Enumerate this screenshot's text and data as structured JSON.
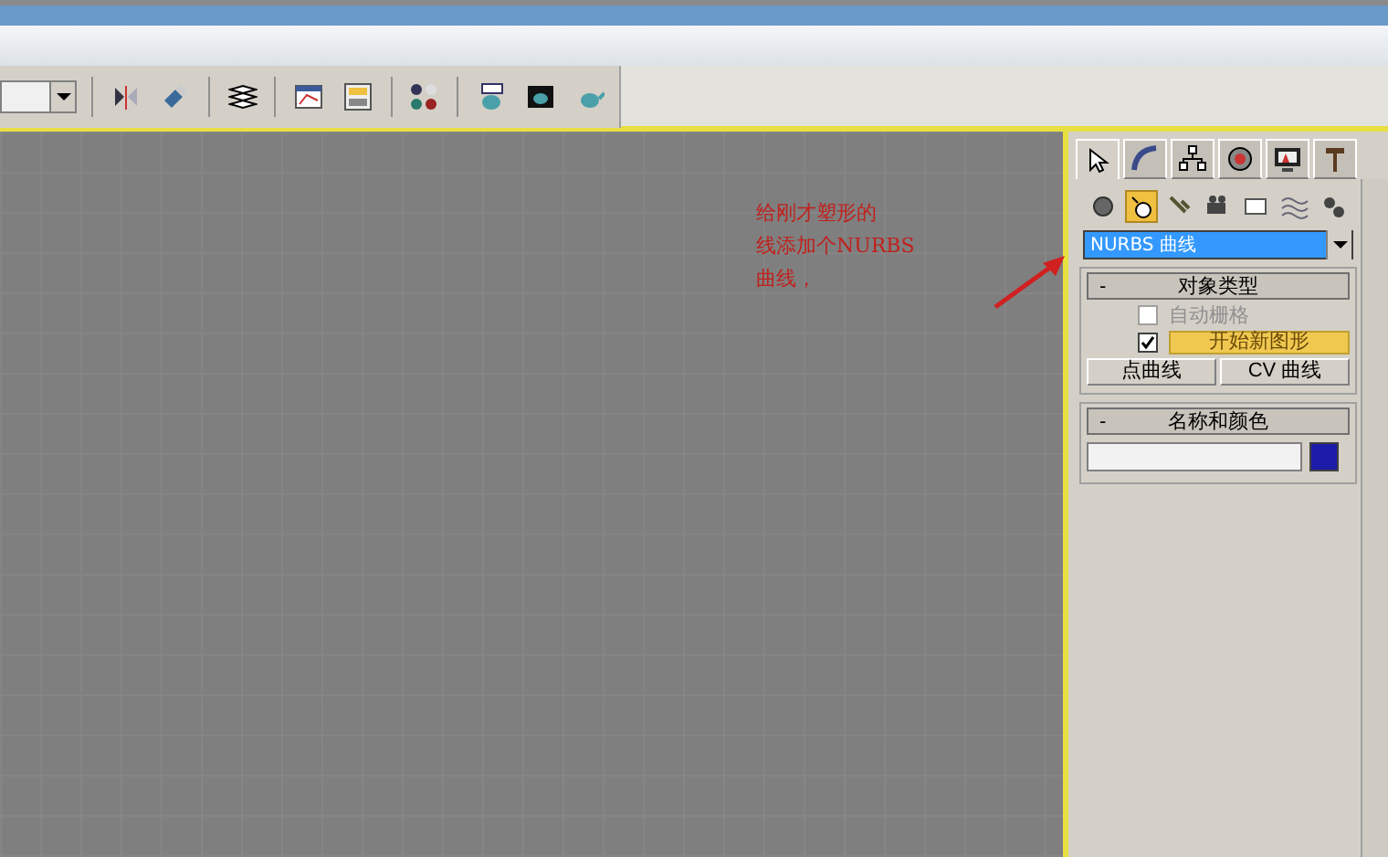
{
  "viewport": {
    "annotation": [
      "给刚才塑形的",
      "线添加个NURBS",
      "曲线，"
    ]
  },
  "command_panel": {
    "tabs": [
      {
        "selected": true
      },
      {
        "selected": false
      },
      {
        "selected": false
      },
      {
        "selected": false
      },
      {
        "selected": false
      },
      {
        "selected": false
      }
    ],
    "categories": [
      {
        "selected": false
      },
      {
        "selected": true
      },
      {
        "selected": false
      },
      {
        "selected": false
      },
      {
        "selected": false
      },
      {
        "selected": false
      },
      {
        "selected": false
      }
    ],
    "type_dropdown": "NURBS 曲线",
    "rollouts": [
      {
        "kind": "object_type",
        "sign": "-",
        "title": "对象类型",
        "checks": [
          {
            "label": "自动栅格",
            "checked": false,
            "disabled": true
          },
          {
            "label": "开始新图形",
            "checked": true,
            "disabled": false
          }
        ],
        "buttons": [
          "点曲线",
          "CV 曲线"
        ]
      },
      {
        "kind": "name_color",
        "sign": "-",
        "title": "名称和颜色",
        "color": "#1c1ca8"
      }
    ]
  }
}
